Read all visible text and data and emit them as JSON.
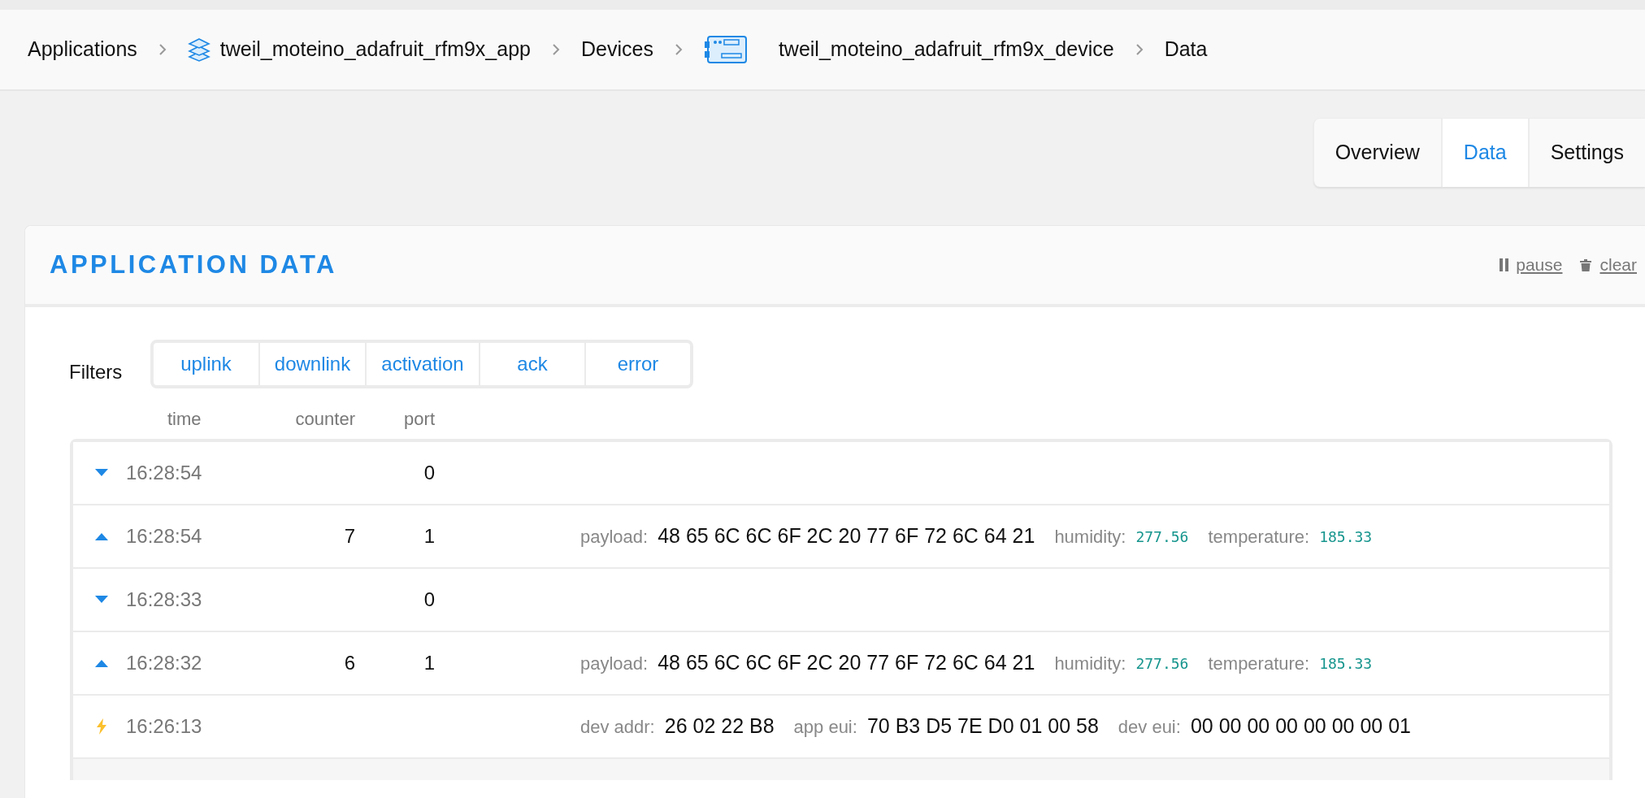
{
  "breadcrumb": [
    {
      "label": "Applications",
      "kind": "plain"
    },
    {
      "label": "tweil_moteino_adafruit_rfm9x_app",
      "kind": "application"
    },
    {
      "label": "Devices",
      "kind": "plain"
    },
    {
      "label": "tweil_moteino_adafruit_rfm9x_device",
      "kind": "device"
    },
    {
      "label": "Data",
      "kind": "plain"
    }
  ],
  "tabs": [
    {
      "label": "Overview",
      "selected": false
    },
    {
      "label": "Data",
      "selected": true
    },
    {
      "label": "Settings",
      "selected": false
    }
  ],
  "panel": {
    "title": "APPLICATION DATA",
    "actions": [
      {
        "label": "pause",
        "kind": "pause"
      },
      {
        "label": "clear",
        "kind": "clear"
      }
    ]
  },
  "filters": {
    "label": "Filters",
    "options": [
      "uplink",
      "downlink",
      "activation",
      "ack",
      "error"
    ]
  },
  "table": {
    "columns": [
      "time",
      "counter",
      "port"
    ],
    "rows": [
      {
        "kind": "downlink",
        "time": "16:28:54",
        "port": "0"
      },
      {
        "kind": "uplink",
        "time": "16:28:54",
        "counter": "7",
        "port": "1",
        "fields": [
          {
            "label": "payload:",
            "value": "48 65 6C 6C 6F 2C 20 77 6F 72 6C 64 21",
            "kind": "text"
          },
          {
            "label": "humidity:",
            "value": "277.56",
            "kind": "number"
          },
          {
            "label": "temperature:",
            "value": "185.33",
            "kind": "number"
          }
        ]
      },
      {
        "kind": "downlink",
        "time": "16:28:33",
        "port": "0"
      },
      {
        "kind": "uplink",
        "time": "16:28:32",
        "counter": "6",
        "port": "1",
        "fields": [
          {
            "label": "payload:",
            "value": "48 65 6C 6C 6F 2C 20 77 6F 72 6C 64 21",
            "kind": "text"
          },
          {
            "label": "humidity:",
            "value": "277.56",
            "kind": "number"
          },
          {
            "label": "temperature:",
            "value": "185.33",
            "kind": "number"
          }
        ]
      },
      {
        "kind": "activation",
        "time": "16:26:13",
        "fields": [
          {
            "label": "dev addr:",
            "value": "26 02 22 B8",
            "kind": "text"
          },
          {
            "label": "app eui:",
            "value": "70 B3 D5 7E D0 01 00 58",
            "kind": "text"
          },
          {
            "label": "dev eui:",
            "value": "00 00 00 00 00 00 00 01",
            "kind": "text"
          }
        ]
      }
    ]
  }
}
